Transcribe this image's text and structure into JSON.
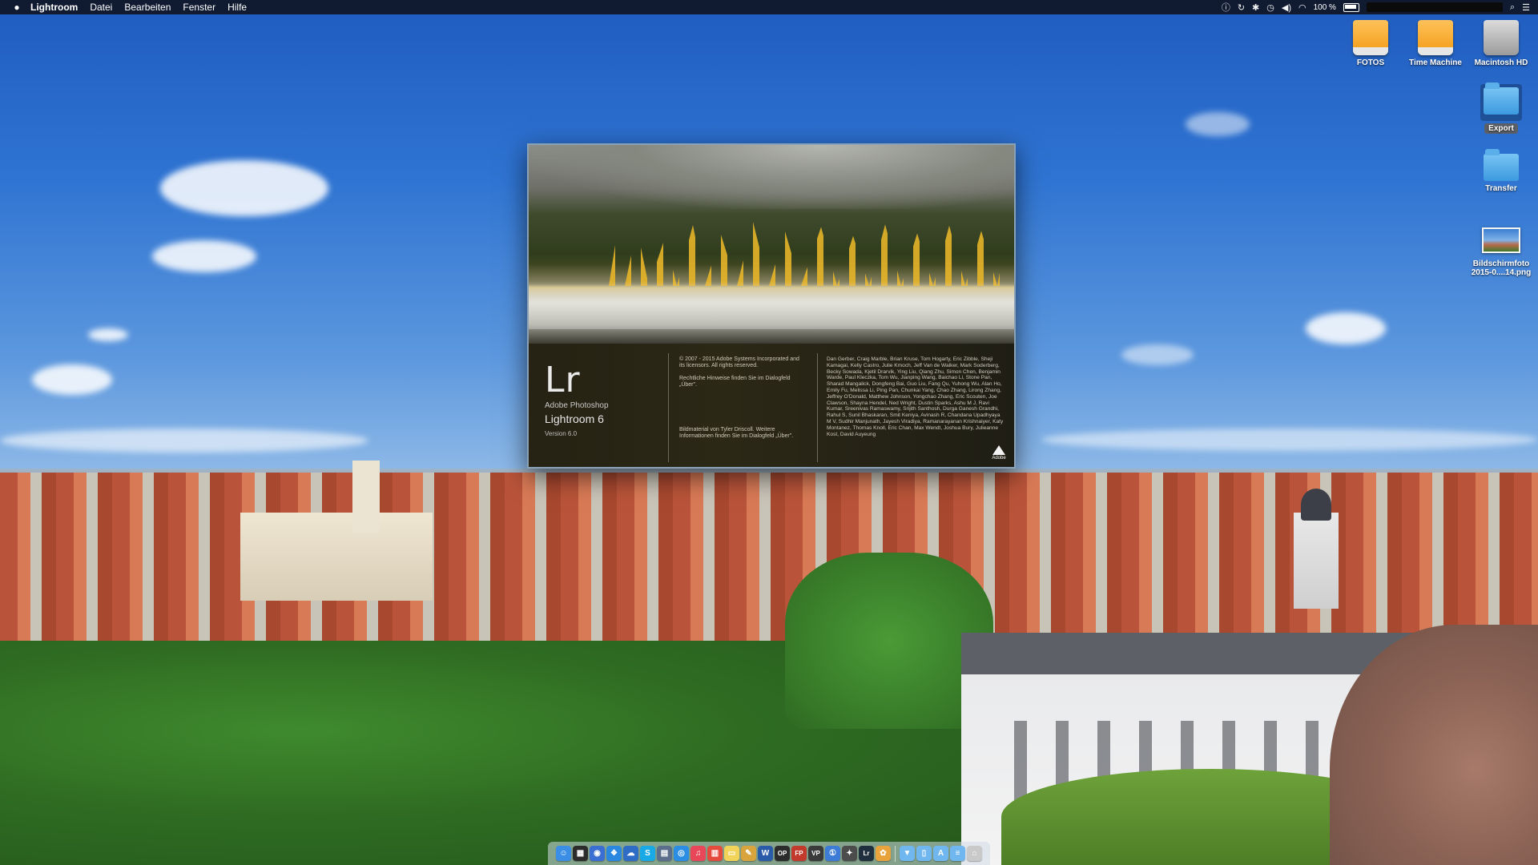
{
  "menubar": {
    "apple_icon": "apple-icon",
    "app_name": "Lightroom",
    "menus": [
      "Datei",
      "Bearbeiten",
      "Fenster",
      "Hilfe"
    ],
    "battery_percent": "100 %"
  },
  "desktop_icons": [
    {
      "label": "FOTOS",
      "icon": "external-drive-icon",
      "color": "#f4a623"
    },
    {
      "label": "Time Machine",
      "icon": "external-drive-icon",
      "color": "#f4a623"
    },
    {
      "label": "Macintosh HD",
      "icon": "hard-drive-icon",
      "color": "#b5b5b5"
    },
    {
      "label": "Export",
      "icon": "folder-icon",
      "color": "#4fa8ea"
    },
    {
      "label": "Transfer",
      "icon": "folder-icon",
      "color": "#4fa8ea"
    },
    {
      "label_line1": "Bildschirmfoto",
      "label_line2": "2015-0....14.png",
      "icon": "image-file-icon"
    }
  ],
  "splash": {
    "logo": "Lr",
    "brand": "Adobe Photoshop",
    "product": "Lightroom 6",
    "version": "Version 6.0",
    "copyright": "© 2007 - 2015 Adobe Systems Incorporated and its licensors. All rights reserved.",
    "legal": "Rechtliche Hinweise finden Sie im Dialogfeld „Über\".",
    "image_credit": "Bildmaterial von Tyler Driscoll. Weitere Informationen finden Sie im Dialogfeld „Über\".",
    "credits": "Dan Gerber, Craig Marble, Brian Kruse, Tom Hogarty, Eric Zibble, Sheji Kamagai, Kelly Castro, Julie Kmoch, Jeff Van de Walker, Mark Soderberg, Becky Sowada, Kjetil Drarvik, Ying Liu, Qiang Zhu, Simon Chen, Benjamin Warde, Paul Kleczka, Tom Wu, Jianping Wang, Baichao Li, Stone Pan, Sharad Mangalick, Dongfeng Bai, Guo Liu, Fang Qu, Yuhong Wu, Alan Ho, Emily Fu, Melissa Li, Ping Pan, Chunkai Yang, Chao Zhang, Lirong Zhang, Jeffrey O'Donald, Matthew Johnson, Yongchao Zhang, Eric Scouten, Joe Clawson, Shayna Hendel, Ned Wright, Dustin Sparks, Ashu M J, Ravi Kumar, Sreenivas Ramaswamy, Srijith Santhosh, Durga Ganesh Grandhi, Rahul S, Sunil Bhaskaran, Smit Keniya, Avinash R, Chandana Upadhyaya M V, Sudhir Manjunath, Jayesh Viradiya, Ramanarayanan Krishnaiyer, Katy Montanez, Thomas Knoll, Eric Chan, Max Wendt, Joshua Bury, Julieanne Kost, David Auyeung",
    "adobe_label": "Adobe"
  },
  "dock": {
    "items": [
      {
        "name": "finder",
        "icon": "finder-icon",
        "glyph": "☺",
        "color": "#3a8ee6"
      },
      {
        "name": "mission-control",
        "icon": "mission-control-icon",
        "glyph": "▦",
        "color": "#2c2c2c"
      },
      {
        "name": "app-3",
        "icon": "app-icon",
        "glyph": "◉",
        "color": "#3b6ed3"
      },
      {
        "name": "dropbox",
        "icon": "dropbox-icon",
        "glyph": "❖",
        "color": "#2a88e0"
      },
      {
        "name": "cloud",
        "icon": "cloud-icon",
        "glyph": "☁",
        "color": "#2f6cc6"
      },
      {
        "name": "skype",
        "icon": "skype-icon",
        "glyph": "S",
        "color": "#19a9e6"
      },
      {
        "name": "preview",
        "icon": "preview-icon",
        "glyph": "▤",
        "color": "#5b6e8c"
      },
      {
        "name": "safari",
        "icon": "safari-icon",
        "glyph": "◎",
        "color": "#2b8de3"
      },
      {
        "name": "itunes",
        "icon": "music-icon",
        "glyph": "♫",
        "color": "#e8475a"
      },
      {
        "name": "calendar",
        "icon": "calendar-icon",
        "glyph": "▥",
        "color": "#e54b3c"
      },
      {
        "name": "notes",
        "icon": "notes-icon",
        "glyph": "▭",
        "color": "#f2d35a"
      },
      {
        "name": "pen",
        "icon": "pen-icon",
        "glyph": "✎",
        "color": "#d9a43c"
      },
      {
        "name": "word",
        "icon": "word-icon",
        "glyph": "W",
        "color": "#2a5ba8"
      },
      {
        "name": "op",
        "icon": "app-icon",
        "glyph": "OP",
        "color": "#2c2c2c"
      },
      {
        "name": "fp",
        "icon": "app-icon",
        "glyph": "FP",
        "color": "#c23a2b"
      },
      {
        "name": "vp",
        "icon": "app-icon",
        "glyph": "VP",
        "color": "#3a3a3a"
      },
      {
        "name": "1password",
        "icon": "lock-icon",
        "glyph": "①",
        "color": "#3c7cd6"
      },
      {
        "name": "tools",
        "icon": "tools-icon",
        "glyph": "✦",
        "color": "#4c4c4c"
      },
      {
        "name": "lightroom",
        "icon": "lightroom-icon",
        "glyph": "Lr",
        "color": "#1f2f3e"
      },
      {
        "name": "photos",
        "icon": "photos-icon",
        "glyph": "✿",
        "color": "#e9a33c"
      }
    ],
    "right_items": [
      {
        "name": "downloads",
        "icon": "folder-icon",
        "glyph": "▼",
        "color": "#6fb7ee"
      },
      {
        "name": "documents",
        "icon": "folder-icon",
        "glyph": "▯",
        "color": "#6fb7ee"
      },
      {
        "name": "applications",
        "icon": "folder-icon",
        "glyph": "A",
        "color": "#6fb7ee"
      },
      {
        "name": "stack",
        "icon": "folder-icon",
        "glyph": "≡",
        "color": "#6fb7ee"
      },
      {
        "name": "trash",
        "icon": "trash-icon",
        "glyph": "⌂",
        "color": "#c9c9c9"
      }
    ]
  }
}
